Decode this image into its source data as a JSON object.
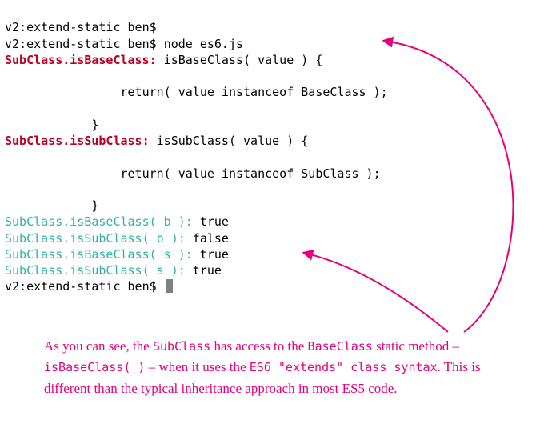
{
  "terminal": {
    "line1": "v2:extend-static ben$",
    "line2_prompt": "v2:extend-static ben$ ",
    "line2_cmd": "node es6.js",
    "l3_key": "SubClass.isBaseClass:",
    "l3_body": " isBaseClass( value ) {",
    "blank": "",
    "l5": "                return( value instanceof BaseClass );",
    "l7": "            }",
    "l8_key": "SubClass.isSubClass:",
    "l8_body": " isSubClass( value ) {",
    "l10": "                return( value instanceof SubClass );",
    "l12": "            }",
    "r1_call": "SubClass.isBaseClass( b ):",
    "r1_val": " true",
    "r2_call": "SubClass.isSubClass( b ):",
    "r2_val": " false",
    "r3_call": "SubClass.isBaseClass( s ):",
    "r3_val": " true",
    "r4_call": "SubClass.isSubClass( s ):",
    "r4_val": " true",
    "final_prompt": "v2:extend-static ben$ "
  },
  "annotation": {
    "t1": "As you can see, the ",
    "c1": "SubClass",
    "t2": " has access to the ",
    "c2": "BaseClass",
    "t3": " static method – ",
    "c3": "isBaseClass( )",
    "t4": "  – when it uses the ",
    "c4": "ES6 \"extends\" class syntax",
    "t5": ". This is different than the typical inheritance approach in most ES5 code."
  }
}
